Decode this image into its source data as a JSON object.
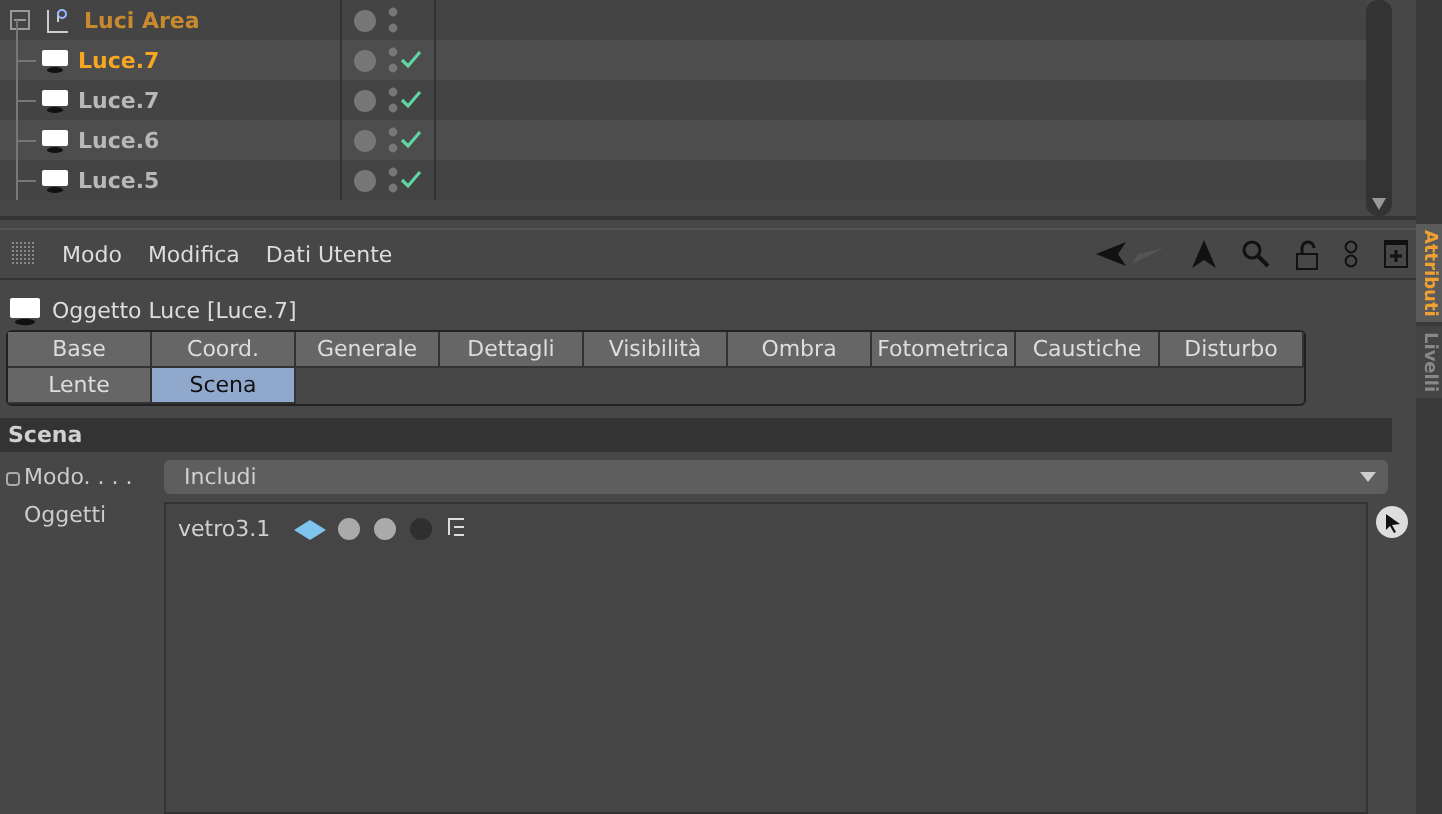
{
  "tree": {
    "group": {
      "label": "Luci Area",
      "expanded": true
    },
    "items": [
      {
        "label": "Luce.7",
        "selected": true,
        "enabled": true
      },
      {
        "label": "Luce.7",
        "selected": false,
        "enabled": true
      },
      {
        "label": "Luce.6",
        "selected": false,
        "enabled": true
      },
      {
        "label": "Luce.5",
        "selected": false,
        "enabled": true
      }
    ]
  },
  "menu": [
    "Modo",
    "Modifica",
    "Dati Utente"
  ],
  "object_title": "Oggetto Luce [Luce.7]",
  "tabs": [
    {
      "label": "Base",
      "selected": false
    },
    {
      "label": "Coord.",
      "selected": false
    },
    {
      "label": "Generale",
      "selected": false
    },
    {
      "label": "Dettagli",
      "selected": false
    },
    {
      "label": "Visibilità",
      "selected": false
    },
    {
      "label": "Ombra",
      "selected": false
    },
    {
      "label": "Fotometrica",
      "selected": false
    },
    {
      "label": "Caustiche",
      "selected": false
    },
    {
      "label": "Disturbo",
      "selected": false
    },
    {
      "label": "Lente",
      "selected": false
    },
    {
      "label": "Scena",
      "selected": true
    }
  ],
  "section": "Scena",
  "mode": {
    "label": "Modo. . . .",
    "value": "Includi"
  },
  "objects": {
    "label": "Oggetti",
    "items": [
      {
        "name": "vetro3.1"
      }
    ]
  },
  "side_tabs": [
    {
      "label": "Attributi",
      "selected": true
    },
    {
      "label": "Livelli",
      "selected": false
    }
  ]
}
